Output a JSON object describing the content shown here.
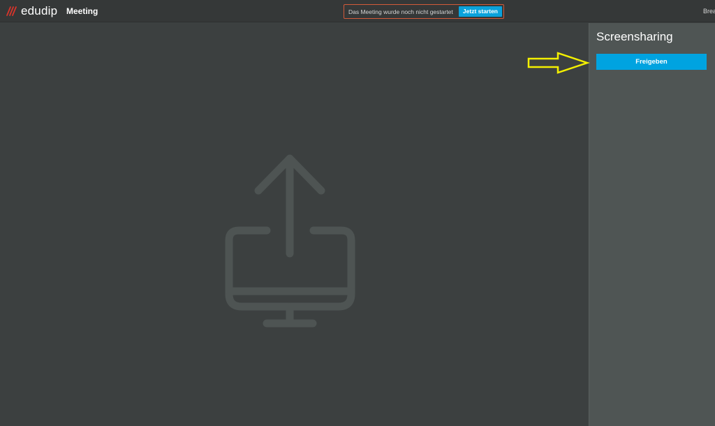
{
  "header": {
    "logo_text": "edudip",
    "nav_meeting": "Meeting",
    "banner_text": "Das Meeting wurde noch nicht gestartet",
    "start_button": "Jetzt starten",
    "clipped_right_text": "Break"
  },
  "sidebar": {
    "title": "Screensharing",
    "share_button": "Freigeben"
  },
  "icons": {
    "logo": "edudip-logo-icon",
    "illustration": "screen-share-upload-icon",
    "annotation": "yellow-arrow-icon"
  },
  "colors": {
    "accent": "#00a3e0",
    "banner_border": "#d35a3a",
    "logo_red": "#d9342b",
    "annotation_arrow": "#f4f000"
  }
}
